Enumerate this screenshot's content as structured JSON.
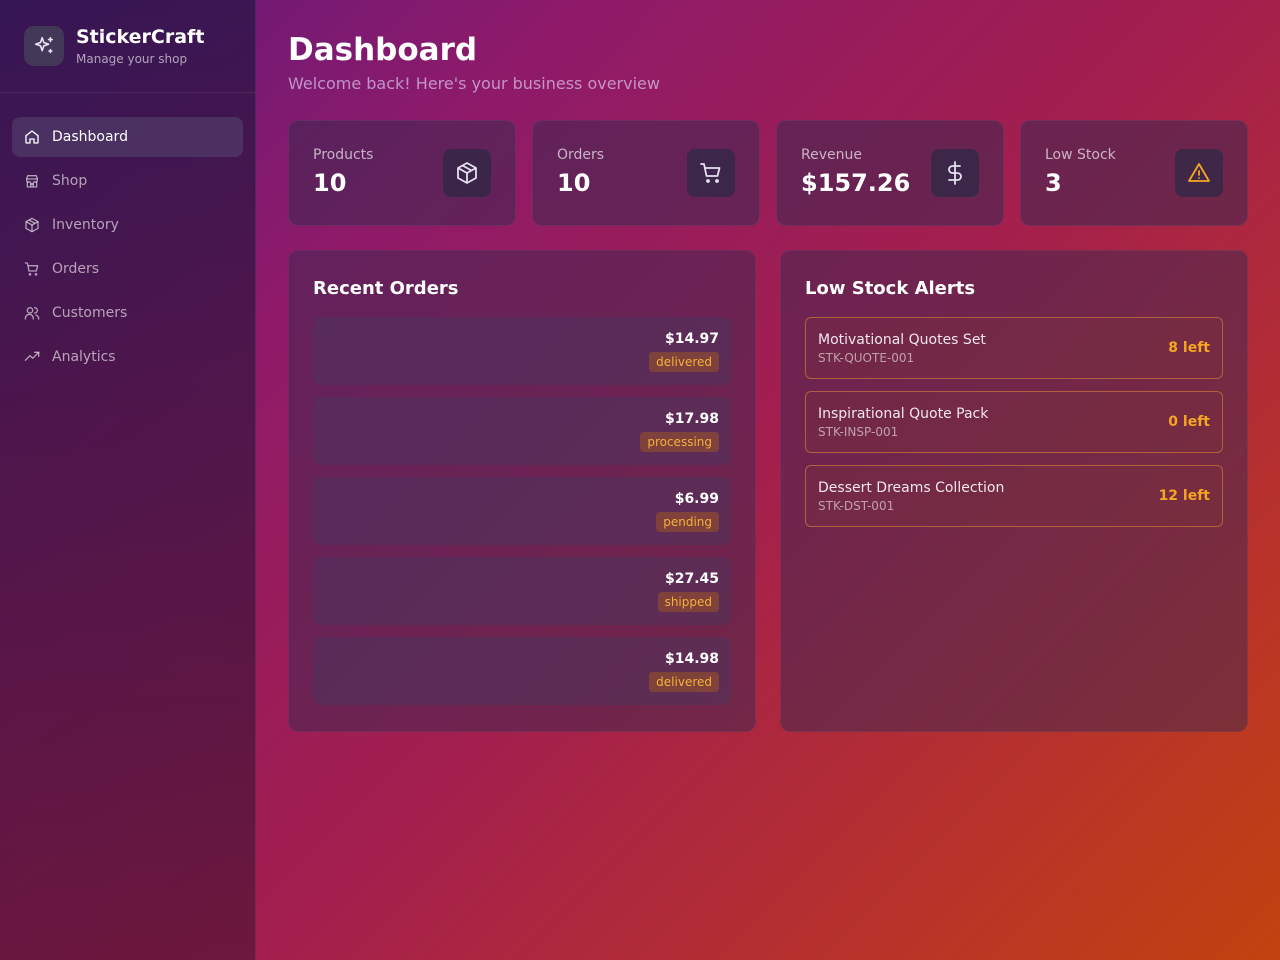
{
  "brand": {
    "title": "StickerCraft",
    "subtitle": "Manage your shop",
    "icon": "sparkles-icon"
  },
  "sidebar": {
    "items": [
      {
        "label": "Dashboard",
        "icon": "home-icon",
        "active": true
      },
      {
        "label": "Shop",
        "icon": "store-icon"
      },
      {
        "label": "Inventory",
        "icon": "package-icon"
      },
      {
        "label": "Orders",
        "icon": "cart-icon"
      },
      {
        "label": "Customers",
        "icon": "users-icon"
      },
      {
        "label": "Analytics",
        "icon": "trending-up-icon"
      }
    ]
  },
  "header": {
    "title": "Dashboard",
    "subtitle": "Welcome back! Here's your business overview"
  },
  "stats": [
    {
      "label": "Products",
      "value": "10",
      "icon": "package-icon"
    },
    {
      "label": "Orders",
      "value": "10",
      "icon": "cart-icon"
    },
    {
      "label": "Revenue",
      "value": "$157.26",
      "icon": "dollar-icon"
    },
    {
      "label": "Low Stock",
      "value": "3",
      "icon": "warning-icon",
      "icon_color": "#f5a623"
    }
  ],
  "recent_orders": {
    "title": "Recent Orders",
    "rows": [
      {
        "amount": "$14.97",
        "status": "delivered"
      },
      {
        "amount": "$17.98",
        "status": "processing"
      },
      {
        "amount": "$6.99",
        "status": "pending"
      },
      {
        "amount": "$27.45",
        "status": "shipped"
      },
      {
        "amount": "$14.98",
        "status": "delivered"
      }
    ]
  },
  "low_stock": {
    "title": "Low Stock Alerts",
    "rows": [
      {
        "name": "Motivational Quotes Set",
        "sku": "STK-QUOTE-001",
        "count": "8 left"
      },
      {
        "name": "Inspirational Quote Pack",
        "sku": "STK-INSP-001",
        "count": "0 left"
      },
      {
        "name": "Dessert Dreams Collection",
        "sku": "STK-DST-001",
        "count": "12 left"
      }
    ]
  },
  "colors": {
    "accent_warning": "#f5a623",
    "status_badge_text": "#f5b13a"
  }
}
